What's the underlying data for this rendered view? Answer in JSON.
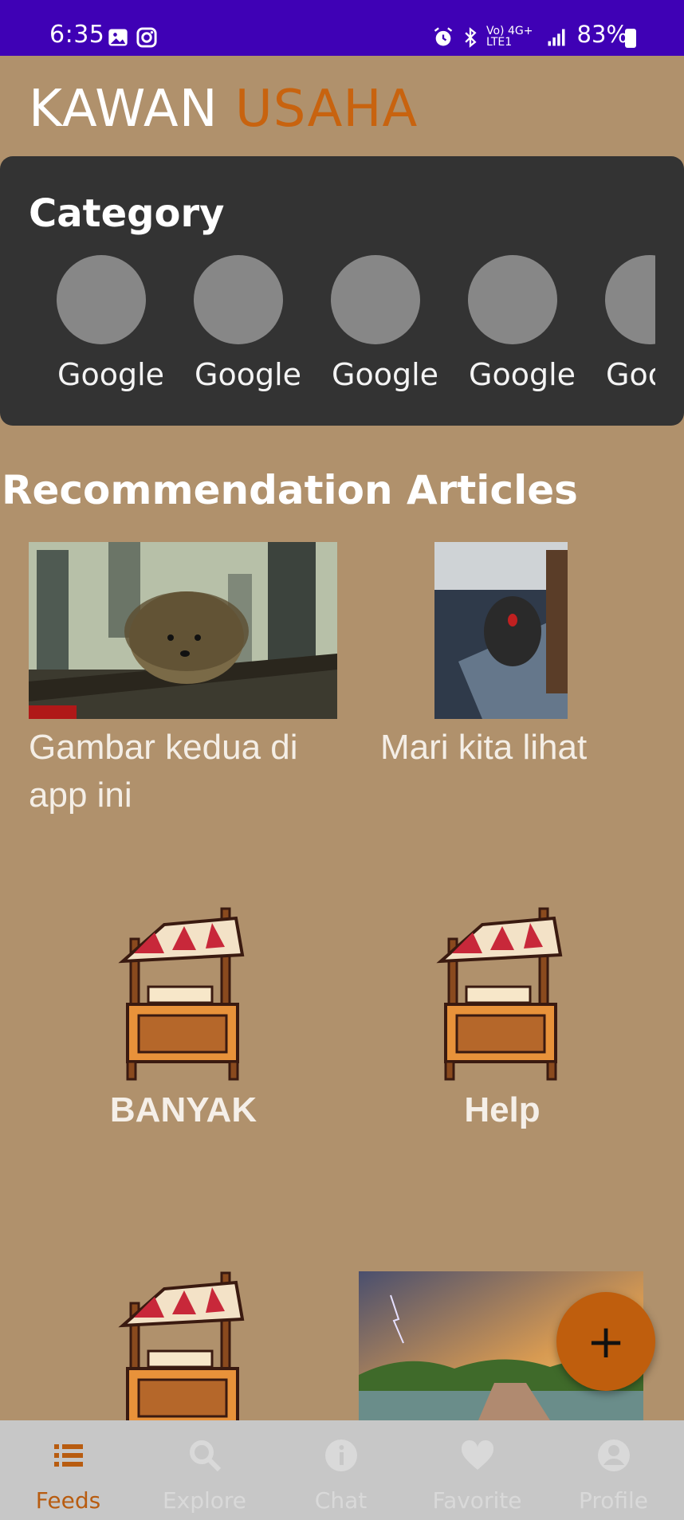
{
  "status_bar": {
    "time": "6:35",
    "network": "Vo) 4G+ LTE1",
    "battery": "83%"
  },
  "app": {
    "title_part1": "KAWAN",
    "title_part2": "USAHA"
  },
  "category": {
    "title": "Category",
    "items": [
      {
        "label": "Google"
      },
      {
        "label": "Google"
      },
      {
        "label": "Google"
      },
      {
        "label": "Google"
      },
      {
        "label": "Google"
      }
    ]
  },
  "recommendation": {
    "title": "Recommendation Articles",
    "articles": [
      {
        "title_line1": "Gambar kedua di",
        "title_line2": "app ini",
        "image": "hedgehog-photo"
      },
      {
        "title_line1": "Mari kita lihat",
        "title_line2": "",
        "image": "mouse-photo"
      },
      {
        "title_line1": "BANYAK",
        "image": "market-stall-icon"
      },
      {
        "title_line1": "Help",
        "image": "market-stall-icon"
      },
      {
        "title_line1": "",
        "image": "market-stall-icon"
      },
      {
        "title_line1": "",
        "image": "landscape-photo"
      }
    ]
  },
  "fab": {
    "icon": "plus-icon"
  },
  "bottom_nav": {
    "items": [
      {
        "label": "Feeds",
        "icon": "list-icon",
        "active": true
      },
      {
        "label": "Explore",
        "icon": "search-icon",
        "active": false
      },
      {
        "label": "Chat",
        "icon": "info-icon",
        "active": false
      },
      {
        "label": "Favorite",
        "icon": "heart-icon",
        "active": false
      },
      {
        "label": "Profile",
        "icon": "account-icon",
        "active": false
      }
    ]
  },
  "colors": {
    "background": "#b0916c",
    "status_bar": "#3f01b5",
    "accent": "#c8630f",
    "card": "#333333"
  }
}
